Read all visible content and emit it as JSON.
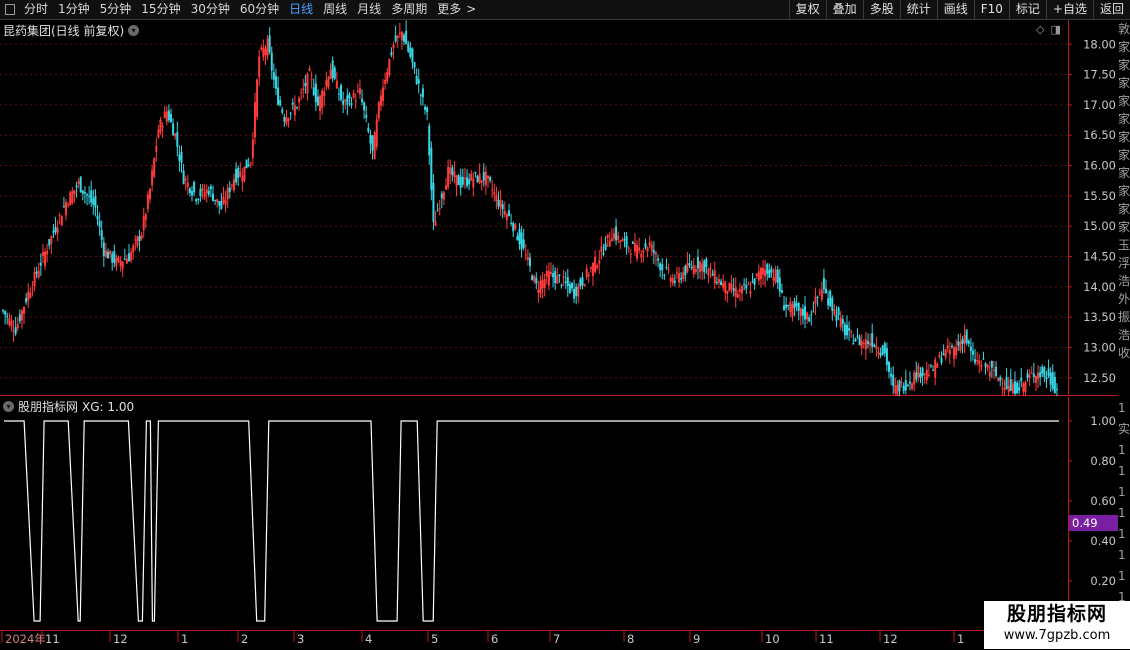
{
  "toolbar": {
    "menu_icon": "menu-square-icon",
    "periods": [
      {
        "label": "分时",
        "active": false
      },
      {
        "label": "1分钟",
        "active": false
      },
      {
        "label": "5分钟",
        "active": false
      },
      {
        "label": "15分钟",
        "active": false
      },
      {
        "label": "30分钟",
        "active": false
      },
      {
        "label": "60分钟",
        "active": false
      },
      {
        "label": "日线",
        "active": true
      },
      {
        "label": "周线",
        "active": false
      },
      {
        "label": "月线",
        "active": false
      },
      {
        "label": "多周期",
        "active": false
      },
      {
        "label": "更多",
        "active": false
      }
    ],
    "more_chevron": ">",
    "tools": [
      "复权",
      "叠加",
      "多股",
      "统计",
      "画线",
      "F10",
      "标记",
      "+自选",
      "返回"
    ]
  },
  "main_chart": {
    "title": "昆药集团(日线 前复权)",
    "title_icon": "chevron-down-circle-icon",
    "corner_icons": [
      "diamond-icon",
      "window-toggle-icon"
    ],
    "price_ticks": [
      "18.00",
      "17.50",
      "17.00",
      "16.50",
      "16.00",
      "15.50",
      "15.00",
      "14.50",
      "14.00",
      "13.50",
      "13.00",
      "12.50"
    ]
  },
  "indicator": {
    "title": "股朋指标网",
    "value_text": "XG: 1.00",
    "title_icon": "chevron-down-circle-icon",
    "ticks": [
      "1.00",
      "0.80",
      "0.60",
      "0.40",
      "0.20"
    ],
    "current_value": "0.49"
  },
  "time_axis": [
    "2024年",
    "11",
    "12",
    "1",
    "2",
    "3",
    "4",
    "5",
    "6",
    "7",
    "8",
    "9",
    "10",
    "11",
    "12",
    "1"
  ],
  "right_strip_chars": [
    "敦",
    "家",
    "家",
    "家",
    "家",
    "家",
    "家",
    "家",
    "家",
    "家",
    "家",
    "家",
    "玉",
    "浮",
    "浩",
    "外",
    "振",
    "浩",
    "收"
  ],
  "right_strip_lower": [
    "1",
    "实",
    "1",
    "1",
    "1",
    "1",
    "1",
    "1",
    "1",
    "1"
  ],
  "colors": {
    "up": "#ff3c3c",
    "down": "#37d7e6",
    "line": "#ffffff",
    "grid": "#5a0d0d",
    "axis": "#c01818",
    "badge": "#7a1fa2"
  },
  "watermark": {
    "title": "股朋指标网",
    "url": "www.7gpzb.com"
  },
  "chart_data": [
    {
      "type": "candlestick",
      "title": "昆药集团(日线 前复权)",
      "ylim": [
        12.2,
        18.4
      ],
      "y_ticks": [
        12.5,
        13.0,
        13.5,
        14.0,
        14.5,
        15.0,
        15.5,
        16.0,
        16.5,
        17.0,
        17.5,
        18.0
      ],
      "x_labels": [
        "2024年",
        "11",
        "12",
        "1",
        "2",
        "3",
        "4",
        "5",
        "6",
        "7",
        "8",
        "9",
        "10",
        "11",
        "12",
        "1"
      ],
      "close_anchors": [
        [
          0,
          13.6
        ],
        [
          6,
          13.3
        ],
        [
          12,
          13.9
        ],
        [
          18,
          14.4
        ],
        [
          24,
          14.9
        ],
        [
          30,
          15.4
        ],
        [
          36,
          15.7
        ],
        [
          44,
          15.3
        ],
        [
          48,
          14.6
        ],
        [
          54,
          14.4
        ],
        [
          60,
          14.5
        ],
        [
          66,
          14.9
        ],
        [
          70,
          15.6
        ],
        [
          74,
          16.6
        ],
        [
          78,
          16.9
        ],
        [
          82,
          16.5
        ],
        [
          86,
          15.8
        ],
        [
          92,
          15.5
        ],
        [
          98,
          15.6
        ],
        [
          104,
          15.3
        ],
        [
          110,
          15.8
        ],
        [
          114,
          15.9
        ],
        [
          118,
          16.1
        ],
        [
          122,
          17.8
        ],
        [
          126,
          18.0
        ],
        [
          130,
          17.2
        ],
        [
          134,
          16.8
        ],
        [
          140,
          17.0
        ],
        [
          146,
          17.5
        ],
        [
          150,
          17.0
        ],
        [
          156,
          17.6
        ],
        [
          162,
          17.0
        ],
        [
          170,
          17.2
        ],
        [
          176,
          16.2
        ],
        [
          180,
          17.2
        ],
        [
          186,
          18.0
        ],
        [
          190,
          18.2
        ],
        [
          194,
          17.8
        ],
        [
          198,
          17.3
        ],
        [
          202,
          16.8
        ],
        [
          205,
          15.0
        ],
        [
          208,
          15.4
        ],
        [
          212,
          15.9
        ],
        [
          218,
          15.7
        ],
        [
          224,
          15.8
        ],
        [
          230,
          15.8
        ],
        [
          236,
          15.4
        ],
        [
          242,
          15.1
        ],
        [
          248,
          14.6
        ],
        [
          254,
          14.0
        ],
        [
          260,
          14.2
        ],
        [
          266,
          14.1
        ],
        [
          272,
          13.9
        ],
        [
          278,
          14.2
        ],
        [
          284,
          14.5
        ],
        [
          290,
          14.9
        ],
        [
          296,
          14.7
        ],
        [
          302,
          14.6
        ],
        [
          308,
          14.7
        ],
        [
          314,
          14.3
        ],
        [
          320,
          14.1
        ],
        [
          326,
          14.3
        ],
        [
          332,
          14.4
        ],
        [
          338,
          14.2
        ],
        [
          344,
          14.0
        ],
        [
          350,
          13.9
        ],
        [
          356,
          14.0
        ],
        [
          362,
          14.3
        ],
        [
          368,
          14.2
        ],
        [
          372,
          13.7
        ],
        [
          378,
          13.6
        ],
        [
          384,
          13.5
        ],
        [
          390,
          14.0
        ],
        [
          396,
          13.6
        ],
        [
          402,
          13.2
        ],
        [
          408,
          13.1
        ],
        [
          414,
          13.1
        ],
        [
          420,
          12.9
        ],
        [
          424,
          12.3
        ],
        [
          430,
          12.4
        ],
        [
          436,
          12.6
        ],
        [
          442,
          12.6
        ],
        [
          448,
          12.9
        ],
        [
          454,
          13.0
        ],
        [
          458,
          13.2
        ],
        [
          462,
          12.8
        ],
        [
          468,
          12.7
        ],
        [
          474,
          12.5
        ],
        [
          480,
          12.3
        ],
        [
          486,
          12.4
        ],
        [
          492,
          12.6
        ],
        [
          498,
          12.5
        ],
        [
          502,
          12.3
        ]
      ]
    },
    {
      "type": "line",
      "title": "股朋指标网",
      "ylim": [
        0,
        1.07
      ],
      "y_ticks": [
        0.2,
        0.4,
        0.6,
        0.8,
        1.0
      ],
      "series": [
        {
          "name": "XG",
          "points": [
            [
              0,
              1
            ],
            [
              10,
              1
            ],
            [
              15,
              0
            ],
            [
              18,
              0
            ],
            [
              20,
              1
            ],
            [
              32,
              1
            ],
            [
              37,
              0
            ],
            [
              38,
              0
            ],
            [
              40,
              1
            ],
            [
              62,
              1
            ],
            [
              67,
              0
            ],
            [
              69,
              0
            ],
            [
              71,
              1
            ],
            [
              73,
              1
            ],
            [
              74,
              0
            ],
            [
              75,
              0
            ],
            [
              77,
              1
            ],
            [
              122,
              1
            ],
            [
              126,
              0
            ],
            [
              130,
              0
            ],
            [
              132,
              1
            ],
            [
              183,
              1
            ],
            [
              186,
              0
            ],
            [
              196,
              0
            ],
            [
              198,
              1
            ],
            [
              206,
              1
            ],
            [
              209,
              0
            ],
            [
              214,
              0
            ],
            [
              216,
              1
            ],
            [
              526,
              1
            ]
          ]
        }
      ]
    }
  ]
}
